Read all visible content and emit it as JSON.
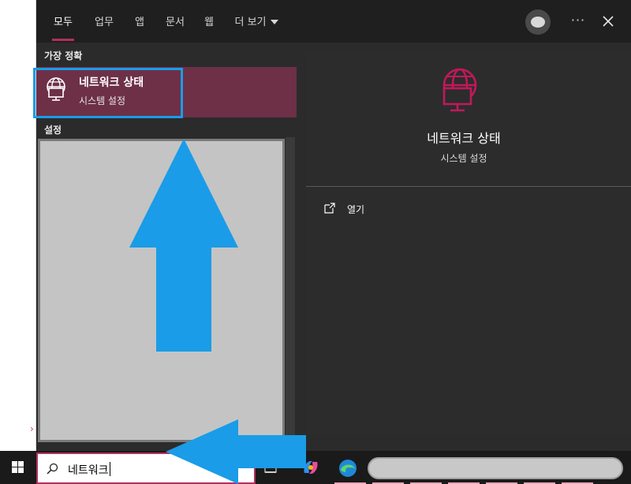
{
  "tabs": [
    {
      "label": "모두",
      "active": true
    },
    {
      "label": "업무"
    },
    {
      "label": "앱"
    },
    {
      "label": "문서"
    },
    {
      "label": "웹"
    },
    {
      "label": "더 보기"
    }
  ],
  "toolbar": {
    "more_label": "···"
  },
  "results": {
    "best_match_header": "가장 정확",
    "best_match": {
      "title": "네트워크 상태",
      "subtitle": "시스템 설정",
      "icon": "network-globe-icon"
    },
    "settings_header": "설정"
  },
  "detail": {
    "title": "네트워크 상태",
    "subtitle": "시스템 설정",
    "icon": "network-globe-icon",
    "actions": [
      {
        "label": "열기",
        "icon": "open-external-icon"
      }
    ]
  },
  "taskbar": {
    "search_value": "네트워크",
    "icons": [
      "windows-start-icon",
      "search-icon",
      "task-view-icon",
      "copilot-icon",
      "edge-icon"
    ]
  },
  "colors": {
    "accent": "#b0305b",
    "selected_row": "#6d3047",
    "annotation": "#1a9ce8",
    "flyout_bg": "#2b2b2b",
    "tab_bar_bg": "#1f1f1f"
  }
}
